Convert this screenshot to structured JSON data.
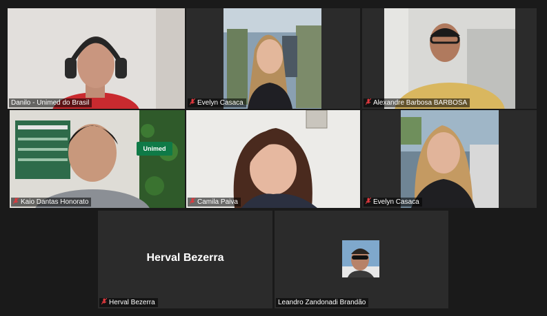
{
  "participants": [
    {
      "name": "Danilo - Unimed do Brasil",
      "muted": false,
      "active": true
    },
    {
      "name": "Evelyn Casaca",
      "muted": true
    },
    {
      "name": "Alexandre Barbosa BARBOSA",
      "muted": true
    },
    {
      "name": "Kaio Dantas Honorato",
      "muted": true
    },
    {
      "name": "Camila Paiva",
      "muted": true
    },
    {
      "name": "Evelyn Casaca",
      "muted": true
    },
    {
      "name": "Herval Bezerra",
      "muted": true,
      "video_off": true
    },
    {
      "name": "Leandro Zandonadi Brandão",
      "muted": false,
      "video_off": true
    }
  ],
  "herval_display_name": "Herval Bezerra",
  "brand_sign": "Unimed",
  "colors": {
    "active_border": "#c8e06a",
    "muted_icon": "#e0393e",
    "tile_bg": "#2b2b2b"
  }
}
